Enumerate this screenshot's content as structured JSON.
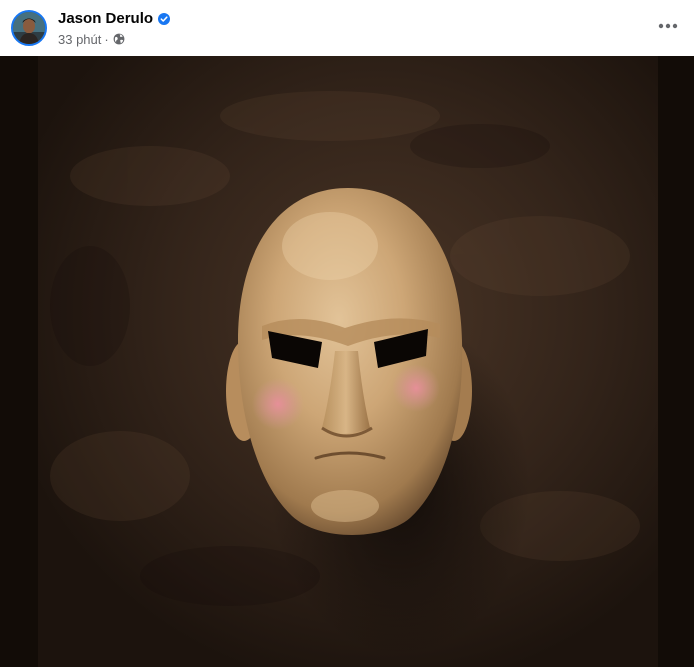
{
  "post": {
    "author": {
      "name": "Jason Derulo",
      "verified_icon": "verified-badge-icon",
      "avatar_icon": "avatar"
    },
    "meta": {
      "time": "33 phút",
      "separator": "·",
      "audience_icon": "globe-icon"
    },
    "more_icon": "more-options-icon",
    "image": {
      "description_icon": "wooden-mask-photo"
    }
  },
  "colors": {
    "author_text": "#050505",
    "meta_text": "#65676b",
    "verified_blue": "#1877f2",
    "image_background": "#2a1c12"
  }
}
